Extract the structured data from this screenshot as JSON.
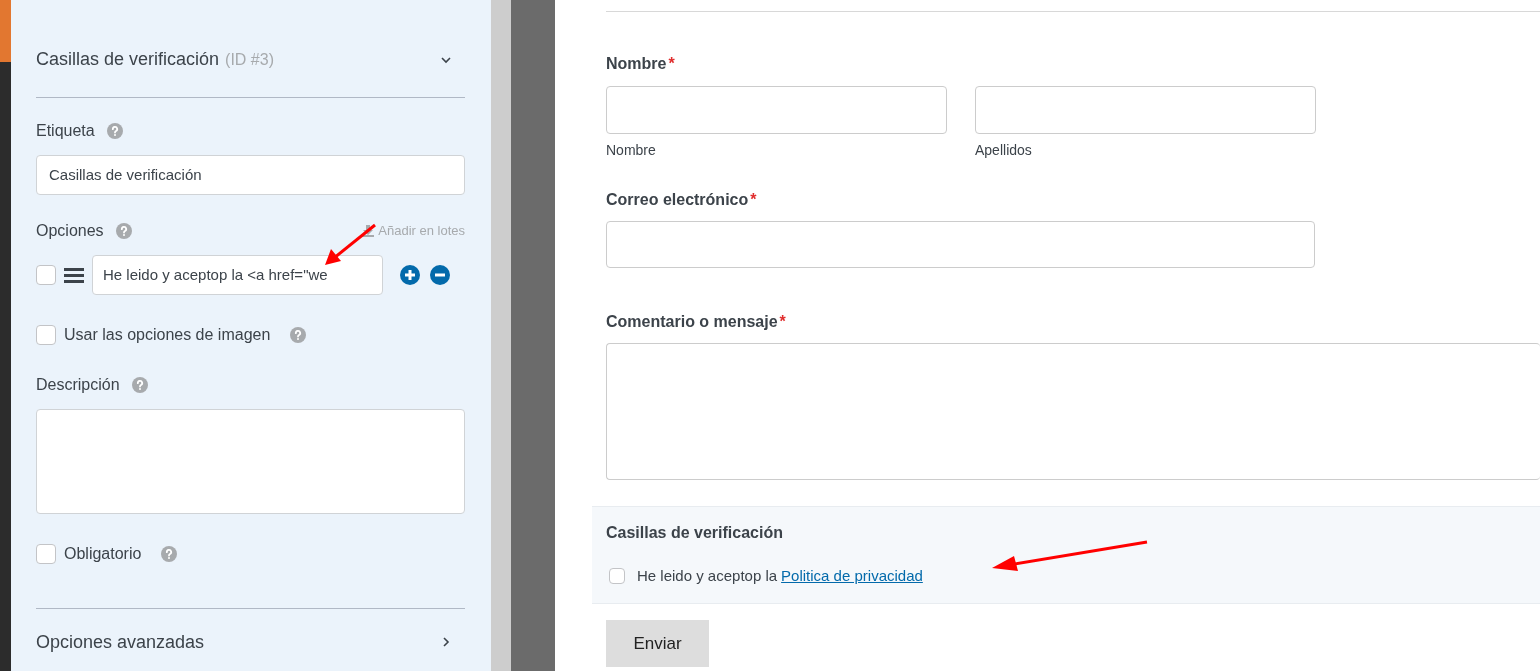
{
  "field_options": {
    "title": "Casillas de verificación",
    "id_label": "(ID #3)",
    "expanded": true,
    "label": {
      "title": "Etiqueta",
      "value": "Casillas de verificación"
    },
    "choices": {
      "title": "Opciones",
      "bulk_add": "Añadir en lotes",
      "items": [
        {
          "value": "He leido y aceptop la <a href=\"we",
          "checked": false
        }
      ]
    },
    "image_choices": {
      "label": "Usar las opciones de imagen",
      "checked": false
    },
    "description": {
      "title": "Descripción"
    },
    "required": {
      "label": "Obligatorio",
      "checked": false
    },
    "advanced": {
      "title": "Opciones avanzadas",
      "expanded": false
    }
  },
  "preview": {
    "name": {
      "label": "Nombre",
      "required_mark": "*",
      "sublabels": [
        "Nombre",
        "Apellidos"
      ]
    },
    "email": {
      "label": "Correo electrónico",
      "required_mark": "*"
    },
    "message": {
      "label": "Comentario o mensaje",
      "required_mark": "*"
    },
    "checkboxes": {
      "label": "Casillas de verificación",
      "items": [
        {
          "text": "He leido y aceptop la",
          "link": "Politica de privacidad",
          "checked": false
        }
      ]
    },
    "submit": "Enviar"
  }
}
